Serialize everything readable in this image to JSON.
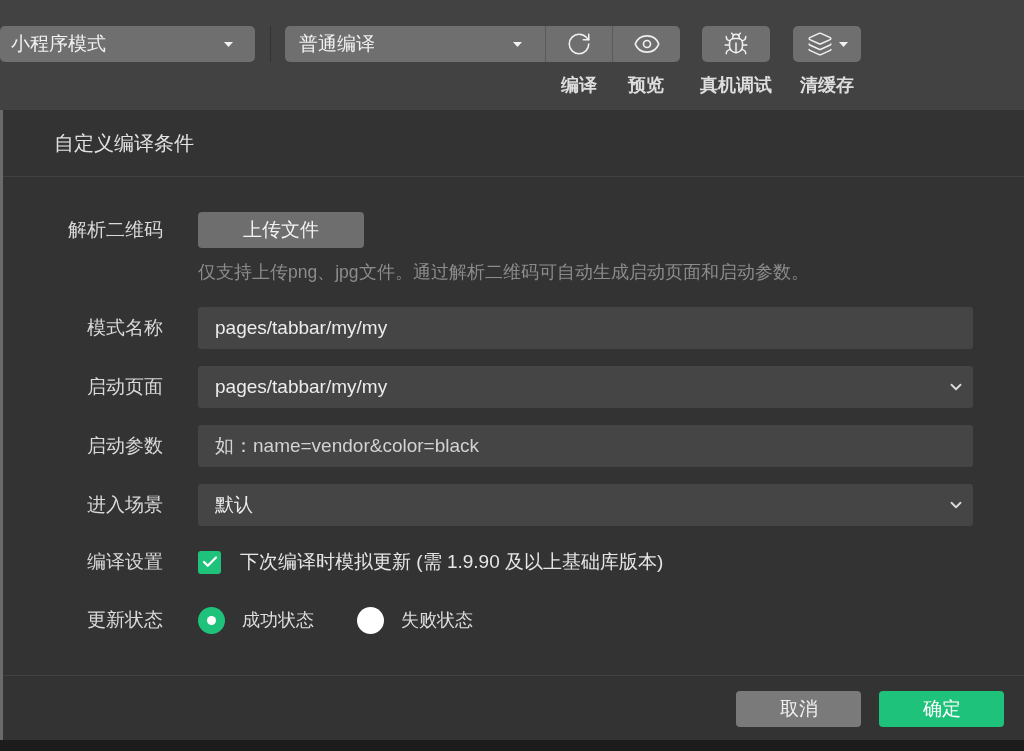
{
  "toolbar": {
    "mode_select": {
      "value": "小程序模式"
    },
    "compile_group": {
      "select": {
        "value": "普通编译"
      },
      "buttons": [
        {
          "kind": "compile",
          "label": "编译"
        },
        {
          "kind": "preview",
          "label": "预览"
        }
      ]
    },
    "tools": [
      {
        "kind": "debug",
        "label": "真机调试"
      },
      {
        "kind": "cache",
        "label": "清缓存"
      }
    ]
  },
  "dialog": {
    "title": "自定义编译条件",
    "rows": [
      {
        "kind": "upload",
        "label": "解析二维码",
        "button": "上传文件",
        "hint": "仅支持上传png、jpg文件。通过解析二维码可自动生成启动页面和启动参数。"
      },
      {
        "kind": "text",
        "label": "模式名称",
        "value": "pages/tabbar/my/my"
      },
      {
        "kind": "select",
        "label": "启动页面",
        "value": "pages/tabbar/my/my"
      },
      {
        "kind": "text",
        "label": "启动参数",
        "placeholder": "如：name=vendor&color=black"
      },
      {
        "kind": "select",
        "label": "进入场景",
        "value": "默认"
      },
      {
        "kind": "checkbox",
        "label": "编译设置",
        "checked": true,
        "text": "下次编译时模拟更新 (需 1.9.90 及以上基础库版本)"
      },
      {
        "kind": "radio",
        "label": "更新状态",
        "options": [
          {
            "label": "成功状态",
            "selected": true
          },
          {
            "label": "失败状态",
            "selected": false
          }
        ]
      }
    ],
    "buttons": [
      {
        "kind": "secondary",
        "label": "取消"
      },
      {
        "kind": "primary",
        "label": "确定"
      }
    ]
  }
}
